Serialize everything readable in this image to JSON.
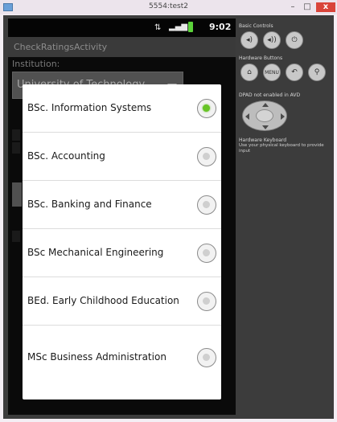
{
  "window": {
    "title": "5554:test2",
    "minimize": "–",
    "maximize": "□",
    "close": "x"
  },
  "statusbar": {
    "data_icon": "data-arrows-icon",
    "signal_icon": "signal-icon",
    "battery_icon": "battery-icon",
    "time": "9:02"
  },
  "activity": {
    "title": "CheckRatingsActivity",
    "institution_label": "Institution:",
    "institution_value": "University of Technology"
  },
  "dialog": {
    "options": [
      {
        "label": "BSc. Information Systems",
        "checked": true
      },
      {
        "label": "BSc. Accounting",
        "checked": false
      },
      {
        "label": "BSc. Banking and Finance",
        "checked": false
      },
      {
        "label": "BSc Mechanical Engineering",
        "checked": false
      },
      {
        "label": "BEd. Early Childhood Education",
        "checked": false
      },
      {
        "label": "MSc Business Administration",
        "checked": false
      }
    ]
  },
  "controls": {
    "basic_controls": "Basic Controls",
    "hardware_buttons": "Hardware Buttons",
    "dpad_heading": "DPAD not enabled in AVD",
    "keyboard_heading": "Hardware Keyboard",
    "keyboard_note": "Use your physical keyboard to provide input",
    "menu_label": "MENU"
  }
}
